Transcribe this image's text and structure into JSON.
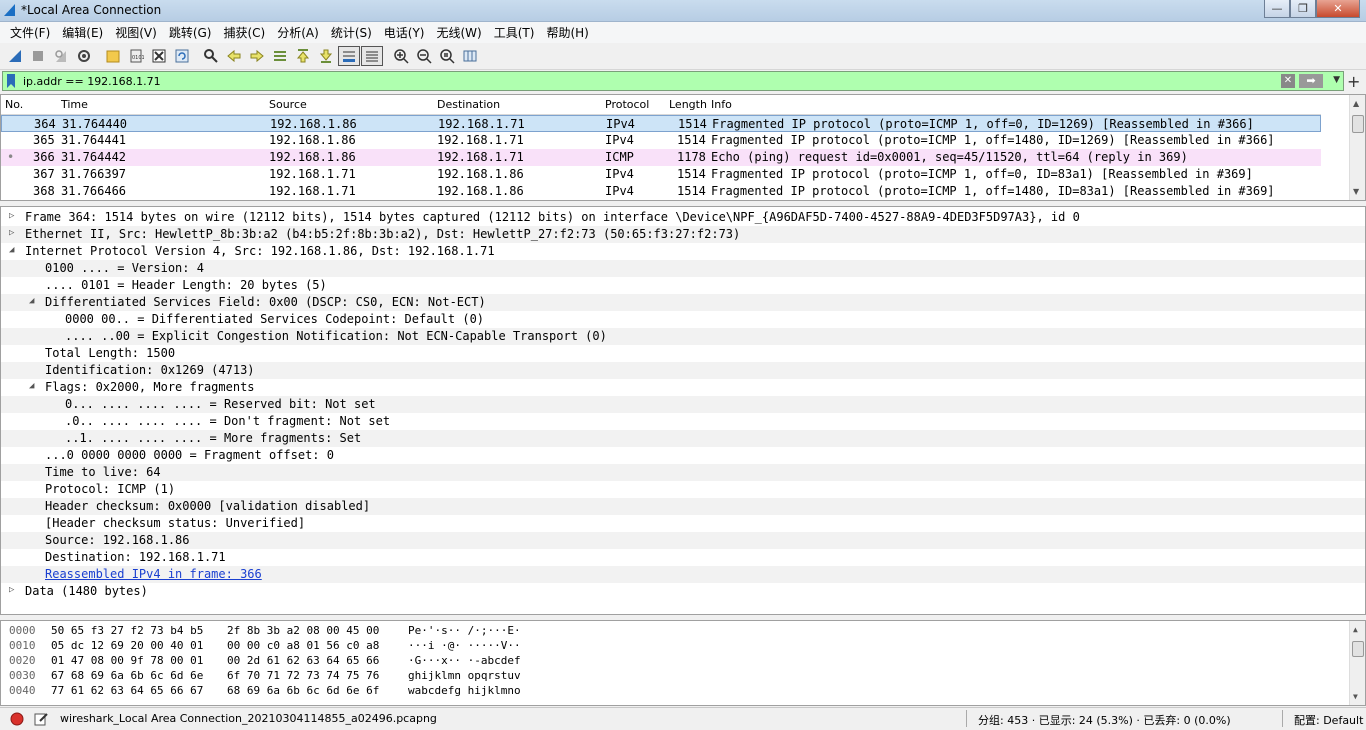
{
  "window": {
    "title": "*Local Area Connection",
    "controls": {
      "minimize": "—",
      "maximize": "❐",
      "close": "✕"
    }
  },
  "menu": [
    {
      "label": "文件(F)"
    },
    {
      "label": "编辑(E)"
    },
    {
      "label": "视图(V)"
    },
    {
      "label": "跳转(G)"
    },
    {
      "label": "捕获(C)"
    },
    {
      "label": "分析(A)"
    },
    {
      "label": "统计(S)"
    },
    {
      "label": "电话(Y)"
    },
    {
      "label": "无线(W)"
    },
    {
      "label": "工具(T)"
    },
    {
      "label": "帮助(H)"
    }
  ],
  "toolbar": {
    "icons": [
      "start-capture-icon",
      "stop-capture-icon",
      "restart-capture-icon",
      "capture-options-icon",
      "open-file-icon",
      "save-file-icon",
      "close-file-icon",
      "reload-file-icon",
      "find-packet-icon",
      "go-back-icon",
      "go-forward-icon",
      "go-to-packet-icon",
      "go-first-icon",
      "go-last-icon",
      "auto-scroll-icon",
      "colorize-icon",
      "zoom-in-icon",
      "zoom-out-icon",
      "zoom-normal-icon",
      "resize-columns-icon"
    ]
  },
  "filter": {
    "value": "ip.addr == 192.168.1.71",
    "apply_arrow": "➡",
    "dropdown": "▼",
    "add_button": "+"
  },
  "packet_list": {
    "columns": [
      "No.",
      "Time",
      "Source",
      "Destination",
      "Protocol",
      "Length",
      "Info"
    ],
    "rows": [
      {
        "no": "364",
        "time": "31.764440",
        "src": "192.168.1.86",
        "dst": "192.168.1.71",
        "proto": "IPv4",
        "len": "1514",
        "info": "Fragmented IP protocol (proto=ICMP 1, off=0, ID=1269) [Reassembled in #366]",
        "marker": ""
      },
      {
        "no": "365",
        "time": "31.764441",
        "src": "192.168.1.86",
        "dst": "192.168.1.71",
        "proto": "IPv4",
        "len": "1514",
        "info": "Fragmented IP protocol (proto=ICMP 1, off=1480, ID=1269) [Reassembled in #366]",
        "marker": ""
      },
      {
        "no": "366",
        "time": "31.764442",
        "src": "192.168.1.86",
        "dst": "192.168.1.71",
        "proto": "ICMP",
        "len": "1178",
        "info": "Echo (ping) request  id=0x0001, seq=45/11520, ttl=64 (reply in 369)",
        "marker": "•"
      },
      {
        "no": "367",
        "time": "31.766397",
        "src": "192.168.1.71",
        "dst": "192.168.1.86",
        "proto": "IPv4",
        "len": "1514",
        "info": "Fragmented IP protocol (proto=ICMP 1, off=0, ID=83a1) [Reassembled in #369]",
        "marker": ""
      },
      {
        "no": "368",
        "time": "31.766466",
        "src": "192.168.1.71",
        "dst": "192.168.1.86",
        "proto": "IPv4",
        "len": "1514",
        "info": "Fragmented IP protocol (proto=ICMP 1, off=1480, ID=83a1) [Reassembled in #369]",
        "marker": ""
      }
    ]
  },
  "details": [
    {
      "text": "Frame 364: 1514 bytes on wire (12112 bits), 1514 bytes captured (12112 bits) on interface \\Device\\NPF_{A96DAF5D-7400-4527-88A9-4DED3F5D97A3}, id 0",
      "tri": "▷"
    },
    {
      "text": "Ethernet II, Src: HewlettP_8b:3b:a2 (b4:b5:2f:8b:3b:a2), Dst: HewlettP_27:f2:73 (50:65:f3:27:f2:73)",
      "tri": "▷"
    },
    {
      "text": "Internet Protocol Version 4, Src: 192.168.1.86, Dst: 192.168.1.71",
      "tri": "◢"
    },
    {
      "text": "0100 .... = Version: 4",
      "tri": ""
    },
    {
      "text": ".... 0101 = Header Length: 20 bytes (5)",
      "tri": ""
    },
    {
      "text": "Differentiated Services Field: 0x00 (DSCP: CS0, ECN: Not-ECT)",
      "tri": "◢"
    },
    {
      "text": "0000 00.. = Differentiated Services Codepoint: Default (0)",
      "tri": ""
    },
    {
      "text": ".... ..00 = Explicit Congestion Notification: Not ECN-Capable Transport (0)",
      "tri": ""
    },
    {
      "text": "Total Length: 1500",
      "tri": ""
    },
    {
      "text": "Identification: 0x1269 (4713)",
      "tri": ""
    },
    {
      "text": "Flags: 0x2000, More fragments",
      "tri": "◢"
    },
    {
      "text": "0... .... .... .... = Reserved bit: Not set",
      "tri": ""
    },
    {
      "text": ".0.. .... .... .... = Don't fragment: Not set",
      "tri": ""
    },
    {
      "text": "..1. .... .... .... = More fragments: Set",
      "tri": ""
    },
    {
      "text": "...0 0000 0000 0000 = Fragment offset: 0",
      "tri": ""
    },
    {
      "text": "Time to live: 64",
      "tri": ""
    },
    {
      "text": "Protocol: ICMP (1)",
      "tri": ""
    },
    {
      "text": "Header checksum: 0x0000 [validation disabled]",
      "tri": ""
    },
    {
      "text": "[Header checksum status: Unverified]",
      "tri": ""
    },
    {
      "text": "Source: 192.168.1.86",
      "tri": ""
    },
    {
      "text": "Destination: 192.168.1.71",
      "tri": ""
    },
    {
      "text": "Reassembled IPv4 in frame: 366",
      "tri": ""
    },
    {
      "text": "Data (1480 bytes)",
      "tri": "▷"
    }
  ],
  "hex": [
    {
      "offset": "0000",
      "bytes1": "50 65 f3 27 f2 73 b4 b5",
      "bytes2": "2f 8b 3b a2 08 00 45 00",
      "ascii": "Pe·'·s·· /·;···E·"
    },
    {
      "offset": "0010",
      "bytes1": "05 dc 12 69 20 00 40 01",
      "bytes2": "00 00 c0 a8 01 56 c0 a8",
      "ascii": "···i ·@· ·····V··"
    },
    {
      "offset": "0020",
      "bytes1": "01 47 08 00 9f 78 00 01",
      "bytes2": "00 2d 61 62 63 64 65 66",
      "ascii": "·G···x·· ·-abcdef"
    },
    {
      "offset": "0030",
      "bytes1": "67 68 69 6a 6b 6c 6d 6e",
      "bytes2": "6f 70 71 72 73 74 75 76",
      "ascii": "ghijklmn opqrstuv"
    },
    {
      "offset": "0040",
      "bytes1": "77 61 62 63 64 65 66 67",
      "bytes2": "68 69 6a 6b 6c 6d 6e 6f",
      "ascii": "wabcdefg hijklmno"
    }
  ],
  "status": {
    "file": "wireshark_Local Area Connection_20210304114855_a02496.pcapng",
    "stats": "分组: 453 · 已显示: 24 (5.3%) · 已丢弃: 0 (0.0%)",
    "profile": "配置: Default"
  },
  "colors": {
    "filter_bg": "#afffaf",
    "selected_row": "#cde4f7",
    "icmp_row": "#f9e1f9",
    "link": "#1a3fd0"
  }
}
